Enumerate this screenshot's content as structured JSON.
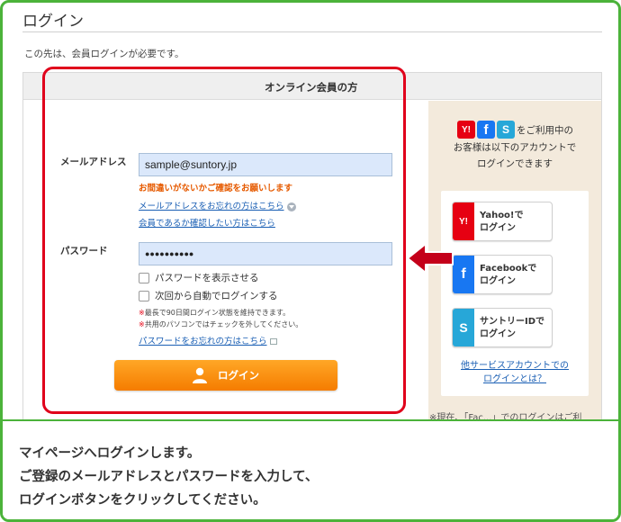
{
  "page": {
    "title": "ログイン",
    "lead": "この先は、会員ログインが必要です。"
  },
  "form": {
    "header": "オンライン会員の方",
    "email_label": "メールアドレス",
    "email_value": "sample@suntory.jp",
    "email_warning": "お間違いがないかご確認をお願いします",
    "forgot_email_link": "メールアドレスをお忘れの方はこちら",
    "check_member_link": "会員であるか確認したい方はこちら",
    "password_label": "パスワード",
    "password_value": "●●●●●●●●●●",
    "show_password": "パスワードを表示させる",
    "auto_login": "次回から自動でログインする",
    "note1": "最長で90日間ログイン状態を維持できます。",
    "note1_mark": "※",
    "note2": "共用のパソコンではチェックを外してください。",
    "note2_mark": "※",
    "forgot_password_link": "パスワードをお忘れの方はこちら",
    "login_button": "ログイン"
  },
  "social": {
    "intro_line1": "をご利用中の",
    "intro_line2": "お客様は以下のアカウントで",
    "intro_line3": "ログインできます",
    "icons": {
      "yahoo": "Y!",
      "facebook": "f",
      "suntory": "S"
    },
    "yahoo_button_line1": "Yahoo!で",
    "yahoo_button_line2": "ログイン",
    "facebook_button_line1": "Facebookで",
    "facebook_button_line2": "ログイン",
    "suntory_button_line1": "サントリーIDで",
    "suntory_button_line2": "ログイン",
    "other_link_line1": "他サービスアカウントでの",
    "other_link_line2": "ログインとは？",
    "partial_text": "※現在、「Fac...」でのログインはご利"
  },
  "caption": {
    "line1": "マイページへログインします。",
    "line2": "ご登録のメールアドレスとパスワードを入力して、",
    "line3": "ログインボタンをクリックしてください。"
  },
  "colors": {
    "frame": "#4bb33a",
    "highlight": "#e0001b",
    "login_button": "#f57c00",
    "warning": "#e65a00",
    "link": "#1a5fb4",
    "yahoo": "#e60012",
    "facebook": "#1877f2",
    "suntory": "#27a7d8"
  }
}
